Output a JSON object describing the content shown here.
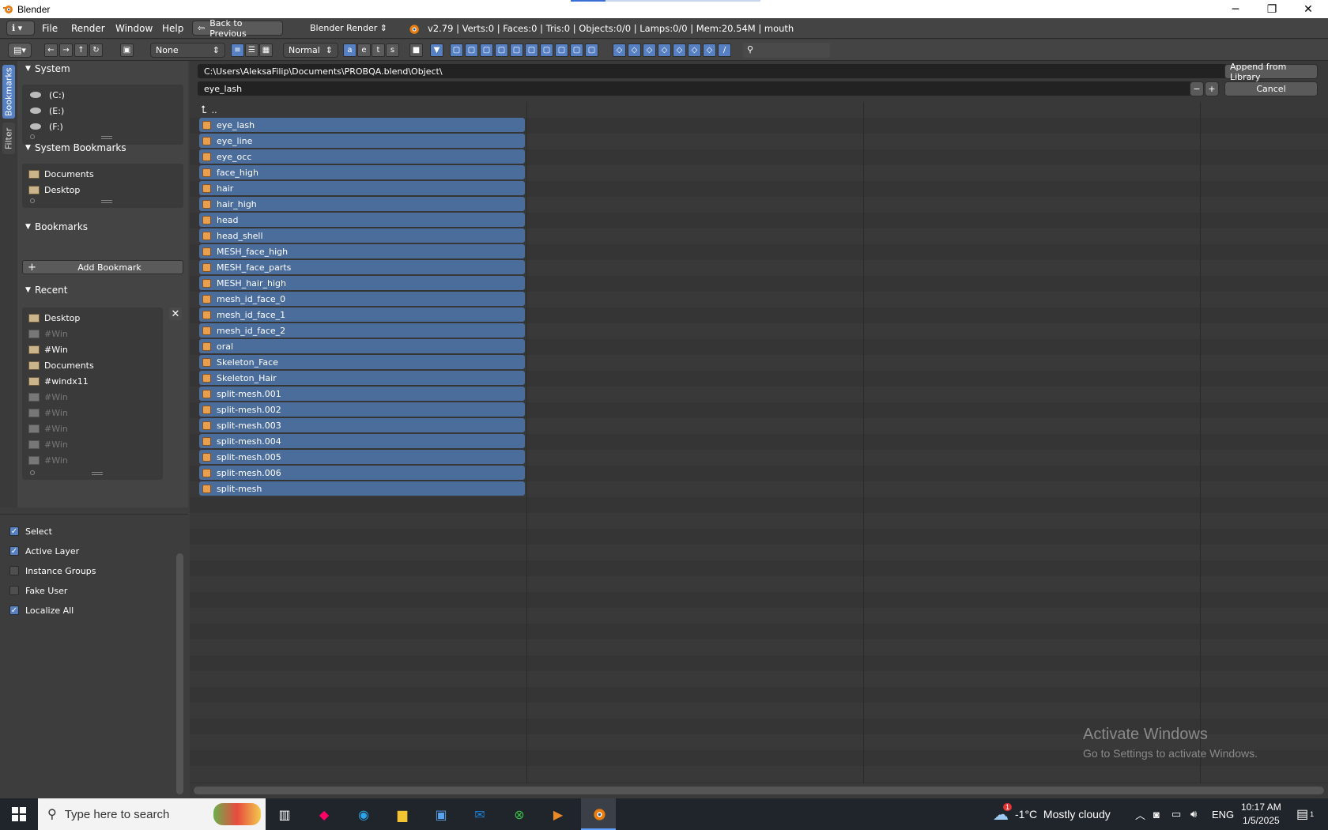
{
  "window": {
    "title": "Blender",
    "minimize": "─",
    "maximize": "❐",
    "close": "✕"
  },
  "menubar": {
    "info_icon": "ℹ",
    "items": [
      "File",
      "Render",
      "Window",
      "Help"
    ],
    "back_button": "Back to Previous",
    "engine": "Blender Render",
    "stats": "v2.79 | Verts:0 | Faces:0 | Tris:0 | Objects:0/0 | Lamps:0/0 | Mem:20.54M | mouth"
  },
  "toolbar": {
    "display_mode": "None",
    "display_size": "Normal"
  },
  "sidetabs": [
    "Bookmarks",
    "Filter"
  ],
  "sidebar": {
    "system": {
      "title": "System",
      "items": [
        "(C:)",
        "(E:)",
        "(F:)"
      ]
    },
    "system_bookmarks": {
      "title": "System Bookmarks",
      "items": [
        "Documents",
        "Desktop"
      ]
    },
    "bookmarks": {
      "title": "Bookmarks",
      "add_label": "Add Bookmark"
    },
    "recent": {
      "title": "Recent",
      "items": [
        {
          "label": "Desktop",
          "dim": false
        },
        {
          "label": "#Win",
          "dim": true
        },
        {
          "label": "#Win",
          "dim": false
        },
        {
          "label": "Documents",
          "dim": false
        },
        {
          "label": "#windx11",
          "dim": false
        },
        {
          "label": "#Win",
          "dim": true
        },
        {
          "label": "#Win",
          "dim": true
        },
        {
          "label": "#Win",
          "dim": true
        },
        {
          "label": "#Win",
          "dim": true
        },
        {
          "label": "#Win",
          "dim": true
        }
      ]
    }
  },
  "options": [
    {
      "label": "Select",
      "checked": true
    },
    {
      "label": "Active Layer",
      "checked": true
    },
    {
      "label": "Instance Groups",
      "checked": false
    },
    {
      "label": "Fake User",
      "checked": false
    },
    {
      "label": "Localize All",
      "checked": true
    }
  ],
  "browser": {
    "path": "C:\\Users\\AleksaFilip\\Documents\\PROBQA.blend\\Object\\",
    "filename": "eye_lash",
    "append_button": "Append from Library",
    "cancel_button": "Cancel",
    "parent": "..",
    "files": [
      "eye_lash",
      "eye_line",
      "eye_occ",
      "face_high",
      "hair",
      "hair_high",
      "head",
      "head_shell",
      "MESH_face_high",
      "MESH_face_parts",
      "MESH_hair_high",
      "mesh_id_face_0",
      "mesh_id_face_1",
      "mesh_id_face_2",
      "oral",
      "Skeleton_Face",
      "Skeleton_Hair",
      "split-mesh.001",
      "split-mesh.002",
      "split-mesh.003",
      "split-mesh.004",
      "split-mesh.005",
      "split-mesh.006",
      "split-mesh"
    ]
  },
  "watermark": {
    "line1": "Activate Windows",
    "line2": "Go to Settings to activate Windows."
  },
  "taskbar": {
    "search_placeholder": "Type here to search",
    "weather": "-1°C  Mostly cloudy",
    "weather_badge": "1",
    "lang": "ENG",
    "time": "10:17 AM",
    "date": "1/5/2025",
    "notif_count": "1"
  }
}
